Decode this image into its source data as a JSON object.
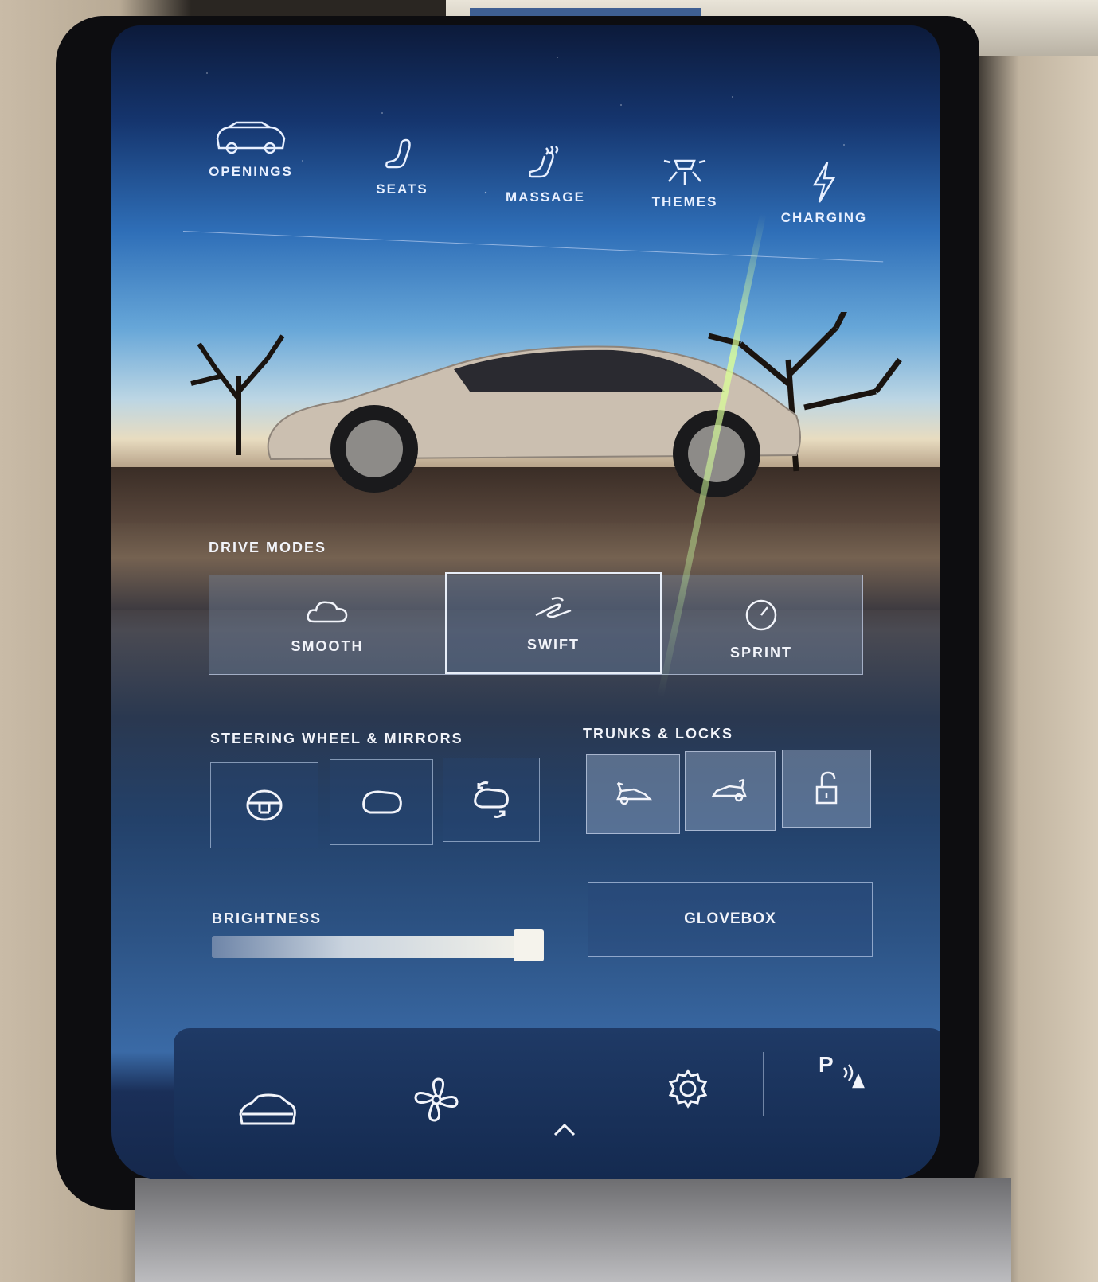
{
  "top_menu": {
    "items": [
      {
        "label": "OPENINGS",
        "icon": "car-openings-icon"
      },
      {
        "label": "SEATS",
        "icon": "seat-icon"
      },
      {
        "label": "MASSAGE",
        "icon": "massage-icon"
      },
      {
        "label": "THEMES",
        "icon": "light-icon"
      },
      {
        "label": "CHARGING",
        "icon": "lightning-icon"
      }
    ]
  },
  "drive_modes": {
    "title": "DRIVE MODES",
    "modes": [
      {
        "label": "SMOOTH",
        "icon": "cloud-icon"
      },
      {
        "label": "SWIFT",
        "icon": "swift-icon"
      },
      {
        "label": "SPRINT",
        "icon": "gauge-icon"
      }
    ],
    "selected": "SWIFT"
  },
  "steering": {
    "title": "STEERING WHEEL & MIRRORS",
    "buttons": [
      "steering-wheel-icon",
      "mirror-icon",
      "mirror-adjust-icon"
    ]
  },
  "trunks": {
    "title": "TRUNKS & LOCKS",
    "buttons": [
      "front-trunk-icon",
      "rear-trunk-icon",
      "unlock-icon"
    ]
  },
  "brightness": {
    "title": "BRIGHTNESS",
    "level": 0.92
  },
  "glovebox": {
    "label": "GLOVEBOX"
  },
  "bottom_bar": {
    "icons": [
      "car-icon",
      "fan-icon",
      "chevron-up-icon",
      "gear-icon",
      "park-assist-icon"
    ],
    "park_label": "P"
  },
  "colors": {
    "text": "#f2f4fa",
    "panel_border": "#d2e1fa"
  }
}
